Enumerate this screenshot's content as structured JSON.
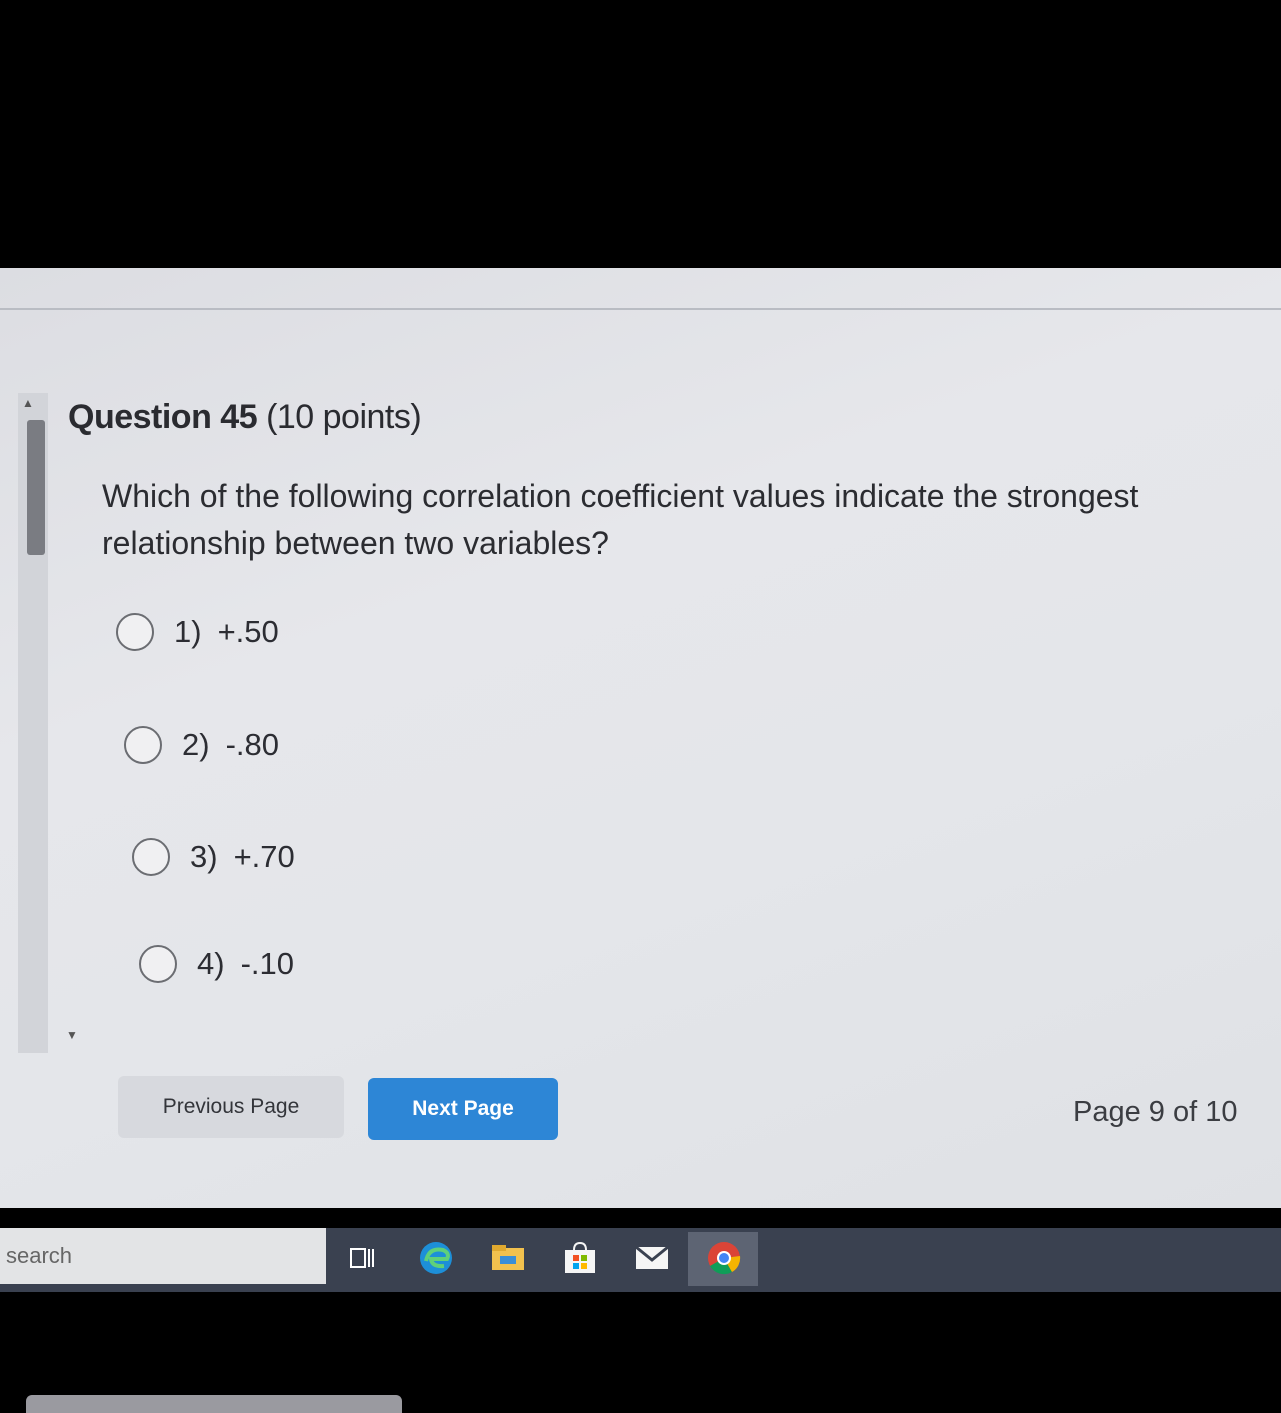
{
  "question": {
    "number_label": "Question 45",
    "points_label": "(10 points)",
    "text": "Which of the following correlation coefficient values indicate the strongest relationship between two variables?"
  },
  "options": [
    {
      "num": "1)",
      "value": "+.50"
    },
    {
      "num": "2)",
      "value": "-.80"
    },
    {
      "num": "3)",
      "value": "+.70"
    },
    {
      "num": "4)",
      "value": "-.10"
    }
  ],
  "nav": {
    "previous_label": "Previous Page",
    "next_label": "Next Page",
    "page_indicator": "Page 9 of 10"
  },
  "taskbar": {
    "search_label": "search",
    "icons": [
      "task-view-icon",
      "edge-icon",
      "file-explorer-icon",
      "store-icon",
      "mail-icon",
      "chrome-icon"
    ]
  },
  "colors": {
    "next_button": "#2d86d6",
    "taskbar": "#3a4150"
  }
}
